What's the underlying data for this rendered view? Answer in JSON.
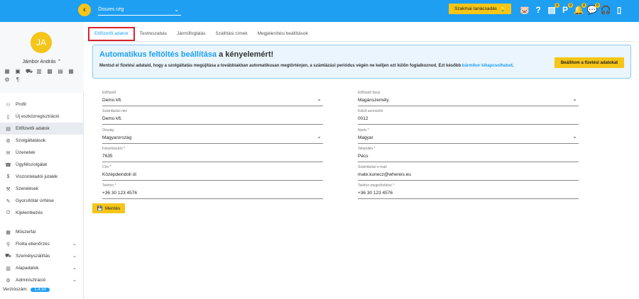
{
  "topbar": {
    "back_icon": "chevron-left-icon",
    "group_select": "Összes cég",
    "advisor_btn": "Szakmai tanácsadás",
    "icons": [
      {
        "name": "piggy-bank-icon",
        "glyph": "🐷",
        "badge": ""
      },
      {
        "name": "help-icon",
        "glyph": "?",
        "badge": ""
      },
      {
        "name": "document-icon",
        "glyph": "▤",
        "badge": "0"
      },
      {
        "name": "parking-icon",
        "glyph": "P",
        "badge": "0"
      },
      {
        "name": "bell-icon",
        "glyph": "🔔",
        "badge": "0"
      },
      {
        "name": "chat-icon",
        "glyph": "💬",
        "badge": "0"
      },
      {
        "name": "headset-icon",
        "glyph": "🎧",
        "badge": ""
      },
      {
        "name": "phone-download-icon",
        "glyph": "▯",
        "badge": ""
      }
    ]
  },
  "user": {
    "initials": "JA",
    "name": "Jámbor András",
    "quick_icons": [
      "▦",
      "▣",
      "⛟",
      "▥",
      "▩",
      "▤",
      "▦",
      "⚙",
      "¶"
    ]
  },
  "nav": {
    "items": [
      {
        "label": "Profil",
        "icon": "⚇"
      },
      {
        "label": "Új eszközregisztráció",
        "icon": "▯"
      },
      {
        "label": "Előfizetői adatok",
        "icon": "▤"
      },
      {
        "label": "Szolgáltatások",
        "icon": "⚙"
      },
      {
        "label": "Üzenetek",
        "icon": "✉"
      },
      {
        "label": "Ügyfélszolgálat",
        "icon": "☎"
      },
      {
        "label": "Viszonteladói jutalék",
        "icon": "$"
      },
      {
        "label": "Szerelések",
        "icon": "⚒"
      },
      {
        "label": "Gyorsítótár ürítése",
        "icon": "✎"
      },
      {
        "label": "Kijelentkezés",
        "icon": "⏻"
      }
    ],
    "items2": [
      {
        "label": "Műszerfal",
        "icon": "▦"
      },
      {
        "label": "Flotta ellenőrzés",
        "icon": "⚲"
      },
      {
        "label": "Személyszállítás",
        "icon": "⛟"
      },
      {
        "label": "Alapadatok",
        "icon": "▥"
      },
      {
        "label": "Adminisztráció",
        "icon": "⚙"
      }
    ],
    "version_label": "Verziószám:",
    "version": "1.4.50"
  },
  "tabs": [
    "Előfizetői adatok",
    "Testreszabás",
    "Járműfoglalás",
    "Szállítási címek",
    "Megjelenítési beállítások"
  ],
  "banner": {
    "title_accent": "Automatikus feltöltés beállítása",
    "title_rest": " a kényelemért!",
    "text": "Mentsd el fizetési adataid, hogy a szolgáltatás megújítása a továbbiakban automatikusan megtörténjen, a számlázási periódus végén ne kelljen ezt külön foglalkoznod. Ezt később ",
    "link": "bármikor kikapcsolhatod",
    "text_end": ".",
    "button": "Beállítom a fizetési adatokat"
  },
  "form": {
    "subscriber": {
      "label": "Előfizető",
      "value": "Demo kft."
    },
    "subscriber_type": {
      "label": "Előfizető típus",
      "value": "Magánszemély"
    },
    "billing_name": {
      "label": "Számlázási név",
      "value": "Demo kft."
    },
    "external_id": {
      "label": "Külső azonosító",
      "value": "0012"
    },
    "country": {
      "label": "Ország",
      "value": "Magyarország"
    },
    "language": {
      "label": "Nyelv *",
      "value": "Magyar"
    },
    "zip": {
      "label": "Irányítószám *",
      "value": "7635"
    },
    "city": {
      "label": "Település *",
      "value": "Pécs"
    },
    "address": {
      "label": "Cím *",
      "value": "Középdeindoli út"
    },
    "billing_email": {
      "label": "Számlázási e-mail",
      "value": "mate.kunecz@whereis.eu"
    },
    "phone": {
      "label": "Telefon *",
      "value": "+36 30 123 4576"
    },
    "phone_confirm": {
      "label": "Telefon megerősítése *",
      "value": "+36 30 123 4576"
    }
  },
  "save_button": "Mentés"
}
